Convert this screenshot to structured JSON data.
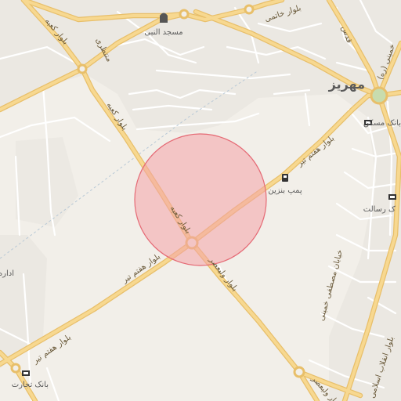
{
  "map": {
    "place_labels": {
      "city": "مهریز",
      "mosque": "مسجد النبی",
      "gas_station": "پمپ بنزین",
      "bank_maskan": "بانک مسکن",
      "bank_resalat": "ک رسالت",
      "bank_tejarat": "بانک تجارت",
      "office": "اداره"
    },
    "road_labels": {
      "kaabeh_north": "بلوار کعبه",
      "kaabeh_center": "بلوار کعبه",
      "haftom_tir_east": "بلوار هفتم تیر",
      "haftom_tir_west": "بلوار هفتم تیر",
      "haftom_tir_sw": "بلوار هفتم تیر",
      "valiasr": "بلوار ولیعصر",
      "valiasr_south": "بلوار ولیعصر",
      "khatami": "بلوار خاتمی",
      "montazeri": "منتظری",
      "khomeini": "خمینی (ره)",
      "mostafa_khomeini": "خیابان مصطفی خمینی",
      "enghelab": "بلوار انقلاب اسلامی",
      "ghods": "قدس"
    },
    "colors": {
      "background": "#f2efe9",
      "primary_road": "#f7d890",
      "primary_road_casing": "#e8bf6a",
      "minor_road": "#ffffff",
      "highlight_fill": "#f4a3a8",
      "highlight_stroke": "#e56a75",
      "park": "#c8dcae"
    },
    "icons": [
      "mosque-icon",
      "fuel-icon",
      "bank-icon"
    ]
  }
}
